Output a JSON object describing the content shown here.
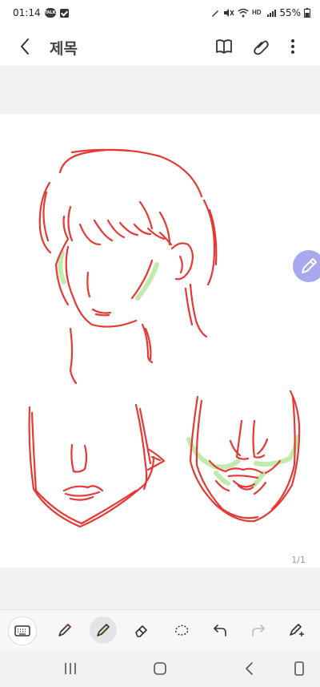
{
  "status_bar": {
    "time": "01:14",
    "notif_badge": "TALK",
    "battery_percent": "55%"
  },
  "app_bar": {
    "title": "제목"
  },
  "canvas": {
    "page_indicator": "1/1",
    "stroke_colors": {
      "pen": "#e53935",
      "highlighter": "#b8e6a0"
    }
  },
  "toolbar": {
    "tools": [
      "keyboard",
      "pen",
      "highlighter",
      "eraser",
      "lasso",
      "undo",
      "redo",
      "pen-settings"
    ],
    "active_tool": "highlighter"
  },
  "colors": {
    "accent": "#a9a7ee",
    "pen_red": "#e53935",
    "highlight_green": "#b8e6a0"
  }
}
